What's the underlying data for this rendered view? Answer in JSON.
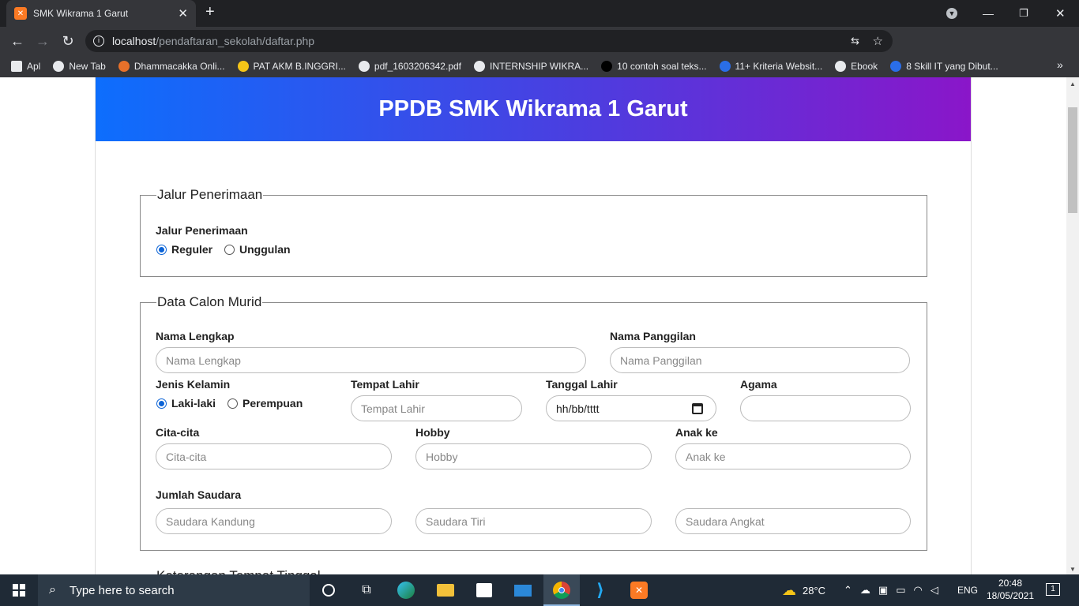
{
  "browser": {
    "tab_title": "SMK Wikrama 1 Garut",
    "url_host": "localhost",
    "url_path": "/pendaftaran_sekolah/daftar.php",
    "bookmarks": [
      {
        "label": "Apl",
        "color": "#e8eaed"
      },
      {
        "label": "New Tab",
        "color": "#e8eaed"
      },
      {
        "label": "Dhammacakka Onli...",
        "color": "#e8712a"
      },
      {
        "label": "PAT AKM B.INGGRI...",
        "color": "#f5c518"
      },
      {
        "label": "pdf_1603206342.pdf",
        "color": "#e8eaed"
      },
      {
        "label": "INTERNSHIP WIKRA...",
        "color": "#e8eaed"
      },
      {
        "label": "10 contoh soal teks...",
        "color": "#000000"
      },
      {
        "label": "11+ Kriteria Websit...",
        "color": "#2a6ee8"
      },
      {
        "label": "Ebook",
        "color": "#e8eaed"
      },
      {
        "label": "8 Skill IT yang Dibut...",
        "color": "#2a6ee8"
      }
    ],
    "more_bookmarks": "»"
  },
  "page": {
    "title": "PPDB SMK Wikrama 1 Garut",
    "section1": {
      "legend": "Jalur Penerimaan",
      "label": "Jalur Penerimaan",
      "options": [
        "Reguler",
        "Unggulan"
      ],
      "selected": "Reguler"
    },
    "section2": {
      "legend": "Data Calon Murid",
      "nama_lengkap_label": "Nama Lengkap",
      "nama_lengkap_placeholder": "Nama Lengkap",
      "nama_panggilan_label": "Nama Panggilan",
      "nama_panggilan_placeholder": "Nama Panggilan",
      "jenis_kelamin_label": "Jenis Kelamin",
      "jenis_kelamin_options": [
        "Laki-laki",
        "Perempuan"
      ],
      "tempat_lahir_label": "Tempat Lahir",
      "tempat_lahir_placeholder": "Tempat Lahir",
      "tanggal_lahir_label": "Tanggal Lahir",
      "tanggal_lahir_placeholder": "hh/bb/tttt",
      "agama_label": "Agama",
      "cita_label": "Cita-cita",
      "cita_placeholder": "Cita-cita",
      "hobby_label": "Hobby",
      "hobby_placeholder": "Hobby",
      "anak_ke_label": "Anak ke",
      "anak_ke_placeholder": "Anak ke",
      "jumlah_saudara_label": "Jumlah Saudara",
      "saudara_kandung_placeholder": "Saudara Kandung",
      "saudara_tiri_placeholder": "Saudara Tiri",
      "saudara_angkat_placeholder": "Saudara Angkat"
    },
    "section3_partial_legend": "Keterangan Tempat Tinggal"
  },
  "taskbar": {
    "search_placeholder": "Type here to search",
    "weather": "28°C",
    "language": "ENG",
    "time": "20:48",
    "date": "18/05/2021",
    "notification_count": "1"
  }
}
